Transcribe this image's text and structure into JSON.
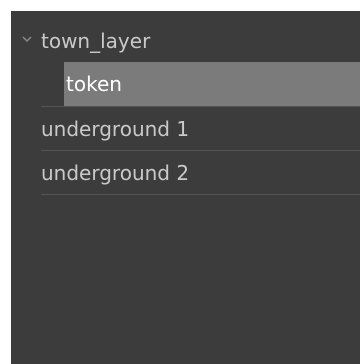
{
  "tree": {
    "parent": {
      "label": "town_layer",
      "expanded": true,
      "icon": "chevron-down-icon"
    },
    "selected_child": {
      "label": "token"
    },
    "items": [
      {
        "label": "underground 1"
      },
      {
        "label": "underground 2"
      }
    ]
  },
  "colors": {
    "panel_bg": "#3c3c3c",
    "selected_bg": "#7b7b7b",
    "text": "#c9c9c9",
    "selected_text": "#ffffff",
    "divider": "#555555"
  }
}
